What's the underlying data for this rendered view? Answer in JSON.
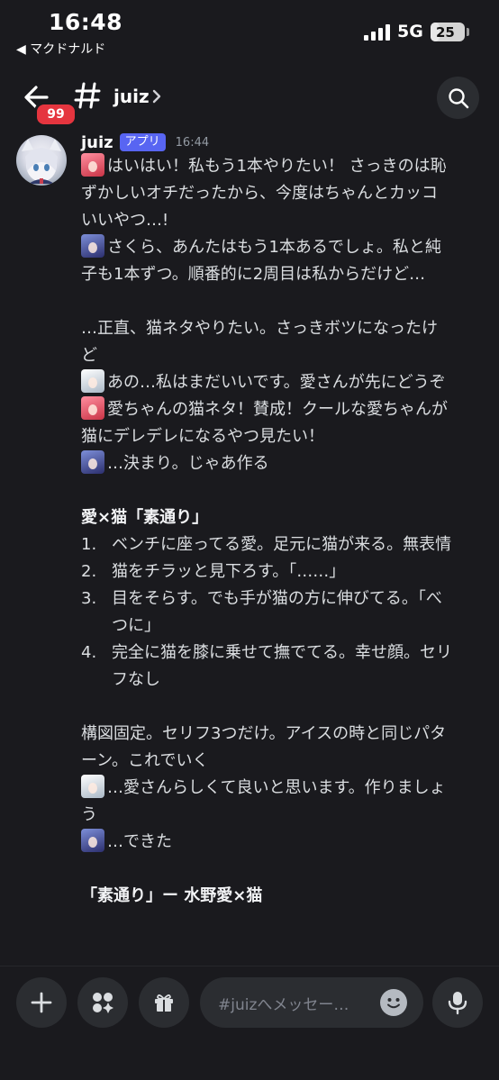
{
  "status_bar": {
    "time": "16:48",
    "back_app": "◀ マクドナルド",
    "network": "5G",
    "battery": "25",
    "battery_level": 0.25
  },
  "header": {
    "unread_count": "99",
    "channel_name": "juiz",
    "back_icon": "arrow-left-icon",
    "hash_icon": "hash-icon",
    "search_icon": "search-icon"
  },
  "message": {
    "author": "juiz",
    "badge": "アプリ",
    "timestamp": "16:44",
    "lines": {
      "l1": "はいはい！私もう1本やりたい！ さっきのは恥",
      "l2": "ずかしいオチだったから、今度はちゃんとカッコ",
      "l3": "いいやつ…!",
      "l4": "さくら、あんたはもう1本あるでしょ。私と純",
      "l5": "子も1本ずつ。順番的に2周目は私からだけど…",
      "l6": "…正直、猫ネタやりたい。さっきボツになったけ",
      "l7": "ど",
      "l8": "あの…私はまだいいです。愛さんが先にどうぞ",
      "l9": "愛ちゃんの猫ネタ！賛成！クールな愛ちゃんが",
      "l10": "猫にデレデレになるやつ見たい！",
      "l11": "…決まり。じゃあ作る",
      "heading1": "愛×猫「素通り」",
      "items": [
        {
          "num": "1.",
          "lines": [
            "ベンチに座ってる愛。足元に猫が来る。無表情"
          ]
        },
        {
          "num": "2.",
          "lines": [
            "猫をチラッと見下ろす。「……」"
          ]
        },
        {
          "num": "3.",
          "lines": [
            "目をそらす。でも手が猫の方に伸びてる。「べ",
            "つに」"
          ]
        },
        {
          "num": "4.",
          "lines": [
            "完全に猫を膝に乗せて撫でてる。幸せ顔。セリ",
            "フなし"
          ]
        }
      ],
      "l12": "構図固定。セリフ3つだけ。アイスの時と同じパタ",
      "l13": "ーン。これでいく",
      "l14": "…愛さんらしくて良いと思います。作りましょ",
      "l15": "う",
      "l16": "…できた",
      "heading2": "「素通り」ー 水野愛×猫"
    }
  },
  "composer": {
    "placeholder": "#juizへメッセー…",
    "plus_icon": "plus-icon",
    "apps_icon": "apps-icon",
    "gift_icon": "gift-icon",
    "emoji_icon": "emoji-icon",
    "mic_icon": "microphone-icon"
  },
  "colors": {
    "background": "#1a1a1e",
    "accent": "#5865f2",
    "badge_red": "#e5353f",
    "text": "#dbdee1"
  }
}
